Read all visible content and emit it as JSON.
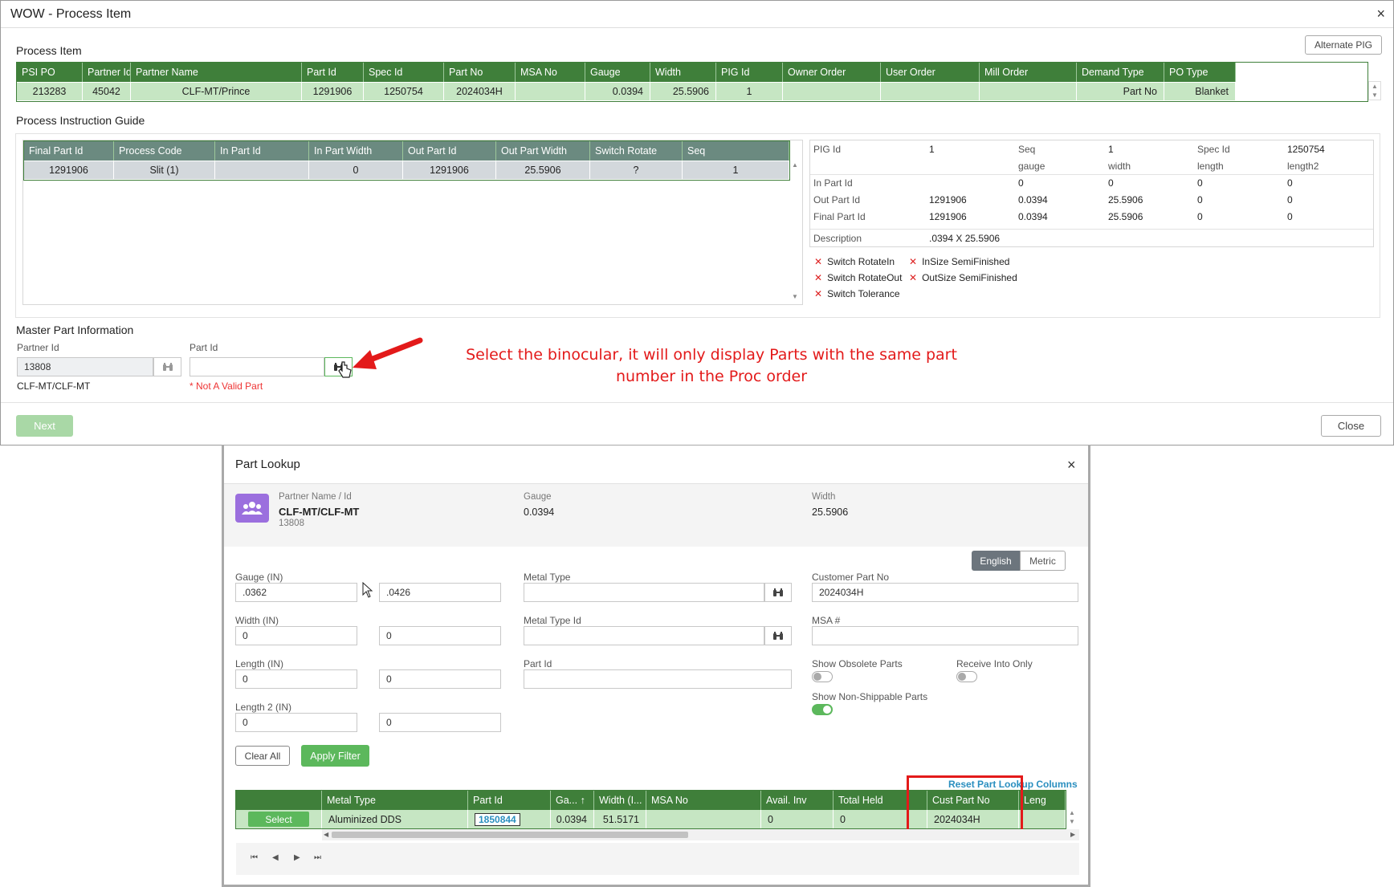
{
  "window": {
    "title": "WOW - Process Item",
    "close": "×"
  },
  "process_item": {
    "title": "Process Item",
    "alternate_pig_label": "Alternate PIG",
    "columns": [
      "PSI PO",
      "Partner Id",
      "Partner Name",
      "Part Id",
      "Spec Id",
      "Part No",
      "MSA No",
      "Gauge",
      "Width",
      "PIG Id",
      "Owner Order",
      "User Order",
      "Mill Order",
      "Demand Type",
      "PO Type"
    ],
    "row": [
      "213283",
      "45042",
      "CLF-MT/Prince",
      "1291906",
      "1250754",
      "2024034H",
      "",
      "0.0394",
      "25.5906",
      "1",
      "",
      "",
      "",
      "Part No",
      "Blanket"
    ]
  },
  "pig": {
    "title": "Process Instruction Guide",
    "columns": [
      "Final Part Id",
      "Process Code",
      "In Part Id",
      "In Part Width",
      "Out Part Id",
      "Out Part Width",
      "Switch Rotate",
      "Seq"
    ],
    "row": [
      "1291906",
      "Slit (1)",
      "",
      "0",
      "1291906",
      "25.5906",
      "?",
      "1"
    ]
  },
  "pig_info": {
    "pig_id_label": "PIG Id",
    "pig_id": "1",
    "seq_label": "Seq",
    "seq": "1",
    "spec_id_label": "Spec Id",
    "spec_id": "1250754",
    "col_headers": [
      "gauge",
      "width",
      "length",
      "length2"
    ],
    "rows": [
      {
        "label": "In Part Id",
        "id": "",
        "vals": [
          "0",
          "0",
          "0",
          "0"
        ]
      },
      {
        "label": "Out Part Id",
        "id": "1291906",
        "vals": [
          "0.0394",
          "25.5906",
          "0",
          "0"
        ]
      },
      {
        "label": "Final Part Id",
        "id": "1291906",
        "vals": [
          "0.0394",
          "25.5906",
          "0",
          "0"
        ]
      }
    ],
    "description_label": "Description",
    "description": ".0394 X 25.5906",
    "flags": [
      "Switch RotateIn",
      "InSize SemiFinished",
      "Switch RotateOut",
      "OutSize SemiFinished",
      "Switch Tolerance"
    ]
  },
  "master_part": {
    "title": "Master Part Information",
    "partner_id_label": "Partner Id",
    "partner_id": "13808",
    "partner_name": "CLF-MT/CLF-MT",
    "part_id_label": "Part Id",
    "part_id": "",
    "error": "* Not A Valid Part"
  },
  "annotation": {
    "line1": "Select the binocular, it will only display Parts with the same part",
    "line2": "number in the Proc order"
  },
  "footer": {
    "next_label": "Next",
    "close_label": "Close"
  },
  "lookup": {
    "title": "Part Lookup",
    "close": "×",
    "partner_label": "Partner Name / Id",
    "partner_name": "CLF-MT/CLF-MT",
    "partner_id": "13808",
    "gauge_label": "Gauge",
    "gauge": "0.0394",
    "width_label": "Width",
    "width": "25.5906",
    "units": [
      "English",
      "Metric"
    ],
    "gauge_in_label": "Gauge (IN)",
    "gauge_min": ".0362",
    "gauge_max": ".0426",
    "width_in_label": "Width (IN)",
    "width_min": "0",
    "width_max": "0",
    "length_in_label": "Length (IN)",
    "length_min": "0",
    "length_max": "0",
    "length2_in_label": "Length 2 (IN)",
    "length2_min": "0",
    "length2_max": "0",
    "metal_type_label": "Metal Type",
    "metal_type": "",
    "metal_type_id_label": "Metal Type Id",
    "metal_type_id": "",
    "part_id_label": "Part Id",
    "part_id": "",
    "cust_part_no_label": "Customer Part No",
    "cust_part_no": "2024034H",
    "msa_label": "MSA #",
    "msa": "",
    "show_obsolete_label": "Show Obsolete Parts",
    "show_obsolete": false,
    "receive_into_label": "Receive Into Only",
    "receive_into": false,
    "show_non_ship_label": "Show Non-Shippable Parts",
    "show_non_ship": true,
    "clear_all_label": "Clear All",
    "apply_filter_label": "Apply Filter",
    "reset_columns_label": "Reset Part Lookup Columns",
    "columns": [
      "",
      "Metal Type",
      "Part Id",
      "Ga... ↑",
      "Width (I...",
      "MSA No",
      "Avail. Inv",
      "Total Held",
      "Cust Part No",
      "Leng"
    ],
    "row": {
      "select_label": "Select",
      "metal_type": "Aluminized DDS",
      "part_id": "1850844",
      "gauge": "0.0394",
      "width": "51.5171",
      "msa": "",
      "avail": "0",
      "held": "0",
      "cust_part_no": "2024034H"
    },
    "pager": [
      "⏮",
      "◀",
      "▶",
      "⏭"
    ]
  },
  "colors": {
    "grid_header": "#3f7f3a",
    "grid_row": "#c6e6c3",
    "accent_green": "#5cb85c",
    "annotation_red": "#e31a1a",
    "purple": "#9b6fde"
  }
}
